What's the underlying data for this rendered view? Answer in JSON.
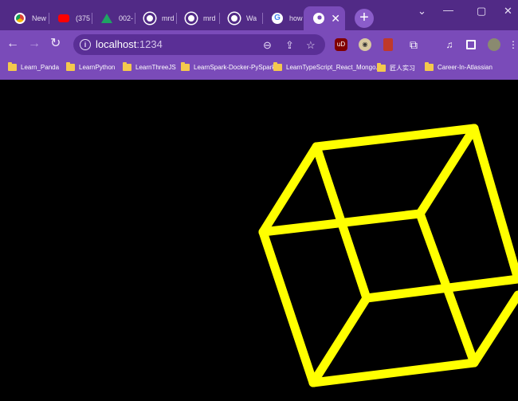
{
  "tabs": [
    {
      "title": "New",
      "favicon": "chrome-icon",
      "color": "#ffffff"
    },
    {
      "title": "(375",
      "favicon": "youtube-icon",
      "color": "#ff0000"
    },
    {
      "title": "002-",
      "favicon": "google-drive-icon",
      "color": "#1fa463"
    },
    {
      "title": "mrd",
      "favicon": "github-icon",
      "color": "#ffffff"
    },
    {
      "title": "mrd",
      "favicon": "github-icon",
      "color": "#ffffff"
    },
    {
      "title": "Wa",
      "favicon": "github-icon",
      "color": "#ffffff"
    },
    {
      "title": "how",
      "favicon": "google-icon",
      "color": "#4285f4"
    },
    {
      "title": "",
      "favicon": "globe-icon",
      "color": "#ffffff",
      "active": true
    }
  ],
  "address": {
    "host": "localhost",
    "path": ":1234"
  },
  "bookmarks": [
    {
      "label": "Learn_Panda"
    },
    {
      "label": "LearnPython"
    },
    {
      "label": "LearnThreeJS"
    },
    {
      "label": "LearnSpark-Docker-PySpark"
    },
    {
      "label": "LearnTypeScript_React_Mongo..."
    },
    {
      "label": "匠人实习"
    },
    {
      "label": "Career-In-Atlassian"
    }
  ],
  "extensions": {
    "ublock_label": "uD"
  },
  "scene": {
    "background": "#000000",
    "wireframe_color": "#ffff00",
    "object": "cube-wireframe"
  },
  "colors": {
    "titlebar": "#512a86",
    "toolbar": "#7a4bb9",
    "omnibox": "#5a2f96"
  }
}
